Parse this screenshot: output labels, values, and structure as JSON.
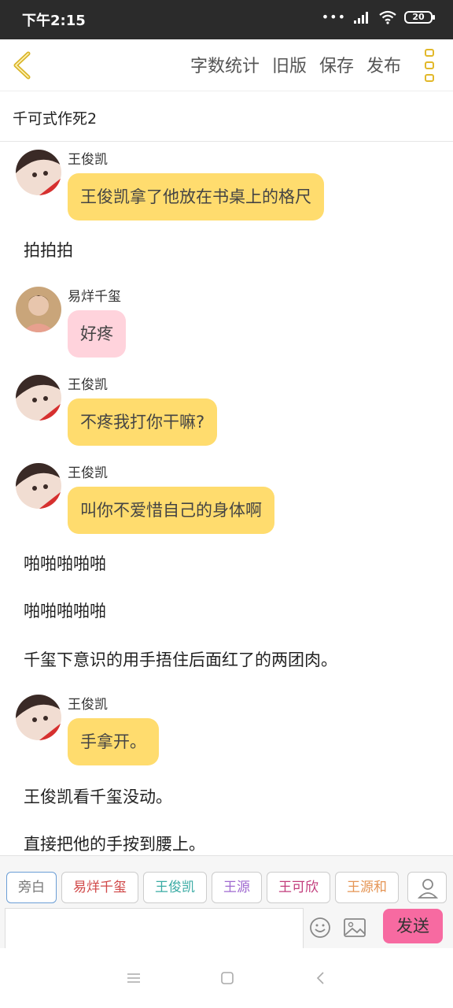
{
  "status": {
    "time": "下午2:15",
    "dots": "•••",
    "battery": "20"
  },
  "toolbar": {
    "word_count": "字数统计",
    "old_version": "旧版",
    "save": "保存",
    "publish": "发布"
  },
  "doc_title": "千可式作死2",
  "messages": [
    {
      "type": "chat",
      "speaker": "王俊凯",
      "text": "王俊凯拿了他放在书桌上的格尺",
      "color": "#ffdc6e"
    },
    {
      "type": "narration",
      "text": "拍拍拍"
    },
    {
      "type": "chat",
      "speaker": "易烊千玺",
      "text": "好疼",
      "color": "#ffd3dc"
    },
    {
      "type": "chat",
      "speaker": "王俊凯",
      "text": "不疼我打你干嘛?",
      "color": "#ffdc6e"
    },
    {
      "type": "chat",
      "speaker": "王俊凯",
      "text": "叫你不爱惜自己的身体啊",
      "color": "#ffdc6e"
    },
    {
      "type": "narration",
      "text": "啪啪啪啪啪"
    },
    {
      "type": "narration",
      "text": "啪啪啪啪啪"
    },
    {
      "type": "narration",
      "text": "千玺下意识的用手捂住后面红了的两团肉。"
    },
    {
      "type": "chat",
      "speaker": "王俊凯",
      "text": "手拿开。",
      "color": "#ffdc6e"
    },
    {
      "type": "narration",
      "text": "王俊凯看千玺没动。"
    },
    {
      "type": "narration",
      "text": "直接把他的手按到腰上。"
    }
  ],
  "roles": [
    {
      "label": "旁白",
      "color": "#777777"
    },
    {
      "label": "易烊千玺",
      "color": "#d04848"
    },
    {
      "label": "王俊凯",
      "color": "#3aaba4"
    },
    {
      "label": "王源",
      "color": "#a06ad0"
    },
    {
      "label": "王可欣",
      "color": "#c23d7c"
    },
    {
      "label": "王源和",
      "color": "#e59555"
    }
  ],
  "send_label": "发送",
  "input_value": "",
  "accent": "#e2b82a"
}
